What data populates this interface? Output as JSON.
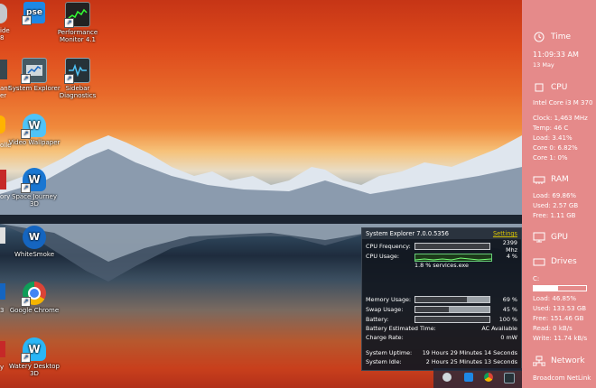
{
  "desktop": {
    "icons": [
      {
        "label": "Performance Monitor 4.1"
      },
      {
        "label": "System Explorer"
      },
      {
        "label": "Sidebar Diagnostics"
      },
      {
        "label": "Video Wallpaper"
      },
      {
        "label": "Space Journey 3D"
      },
      {
        "label": "WhiteSmoke"
      },
      {
        "label": "Google Chrome"
      },
      {
        "label": "Watery Desktop 3D"
      }
    ],
    "pse_text": "pse",
    "edge_labels": [
      "ide",
      "8",
      "ant",
      "er",
      "olle",
      "ory",
      "3",
      "y"
    ]
  },
  "system_explorer": {
    "title": "System Explorer  7.0.0.5356",
    "settings_label": "Settings",
    "rows": [
      {
        "label": "CPU Frequency:",
        "value": "2399 Mhz",
        "fill": 1.0
      },
      {
        "label": "CPU Usage:",
        "value": "4 %"
      },
      {
        "label": "Memory Usage:",
        "value": "69 %",
        "fill": 0.69
      },
      {
        "label": "Swap Usage:",
        "value": "45 %",
        "fill": 0.45
      },
      {
        "label": "Battery:",
        "value": "100 %",
        "fill": 1.0
      }
    ],
    "services_note": "1.8 % services.exe",
    "battery_time_label": "Battery Estimated Time:",
    "battery_time_value": "AC Available",
    "charge_rate_label": "Charge Rate:",
    "charge_rate_value": "0 mW",
    "uptime_label": "System Uptime:",
    "uptime_value": "19 Hours 29 Minutes 14 Seconds",
    "idle_label": "System Idle:",
    "idle_value": "2 Hours 25 Minutes 13 Seconds"
  },
  "sidebar": {
    "time": {
      "title": "Time",
      "clock": "11:09:33 AM",
      "date": "13 May"
    },
    "cpu": {
      "title": "CPU",
      "model": "Intel Core i3 M 370",
      "lines": [
        "Clock: 1,463 MHz",
        "Temp: 46 C",
        "Load: 3.41%",
        "Core 0: 6.82%",
        "Core 1: 0%"
      ]
    },
    "ram": {
      "title": "RAM",
      "lines": [
        "Load: 69.86%",
        "Used: 2.57 GB",
        "Free: 1.11 GB"
      ]
    },
    "gpu": {
      "title": "GPU"
    },
    "drives": {
      "title": "Drives",
      "drive_letter": "C:",
      "load_fraction": 0.4685,
      "lines": [
        "Load: 46.85%",
        "Used: 133.53 GB",
        "Free: 151.46 GB",
        "Read: 0 kB/s",
        "Write: 11.74 kB/s"
      ]
    },
    "network": {
      "title": "Network",
      "adapter": "Broadcom NetLink"
    }
  },
  "colors": {
    "sidebar_bg": "#e58a8a",
    "gadget_bg": "#121820",
    "settings_link": "#d9c400"
  }
}
